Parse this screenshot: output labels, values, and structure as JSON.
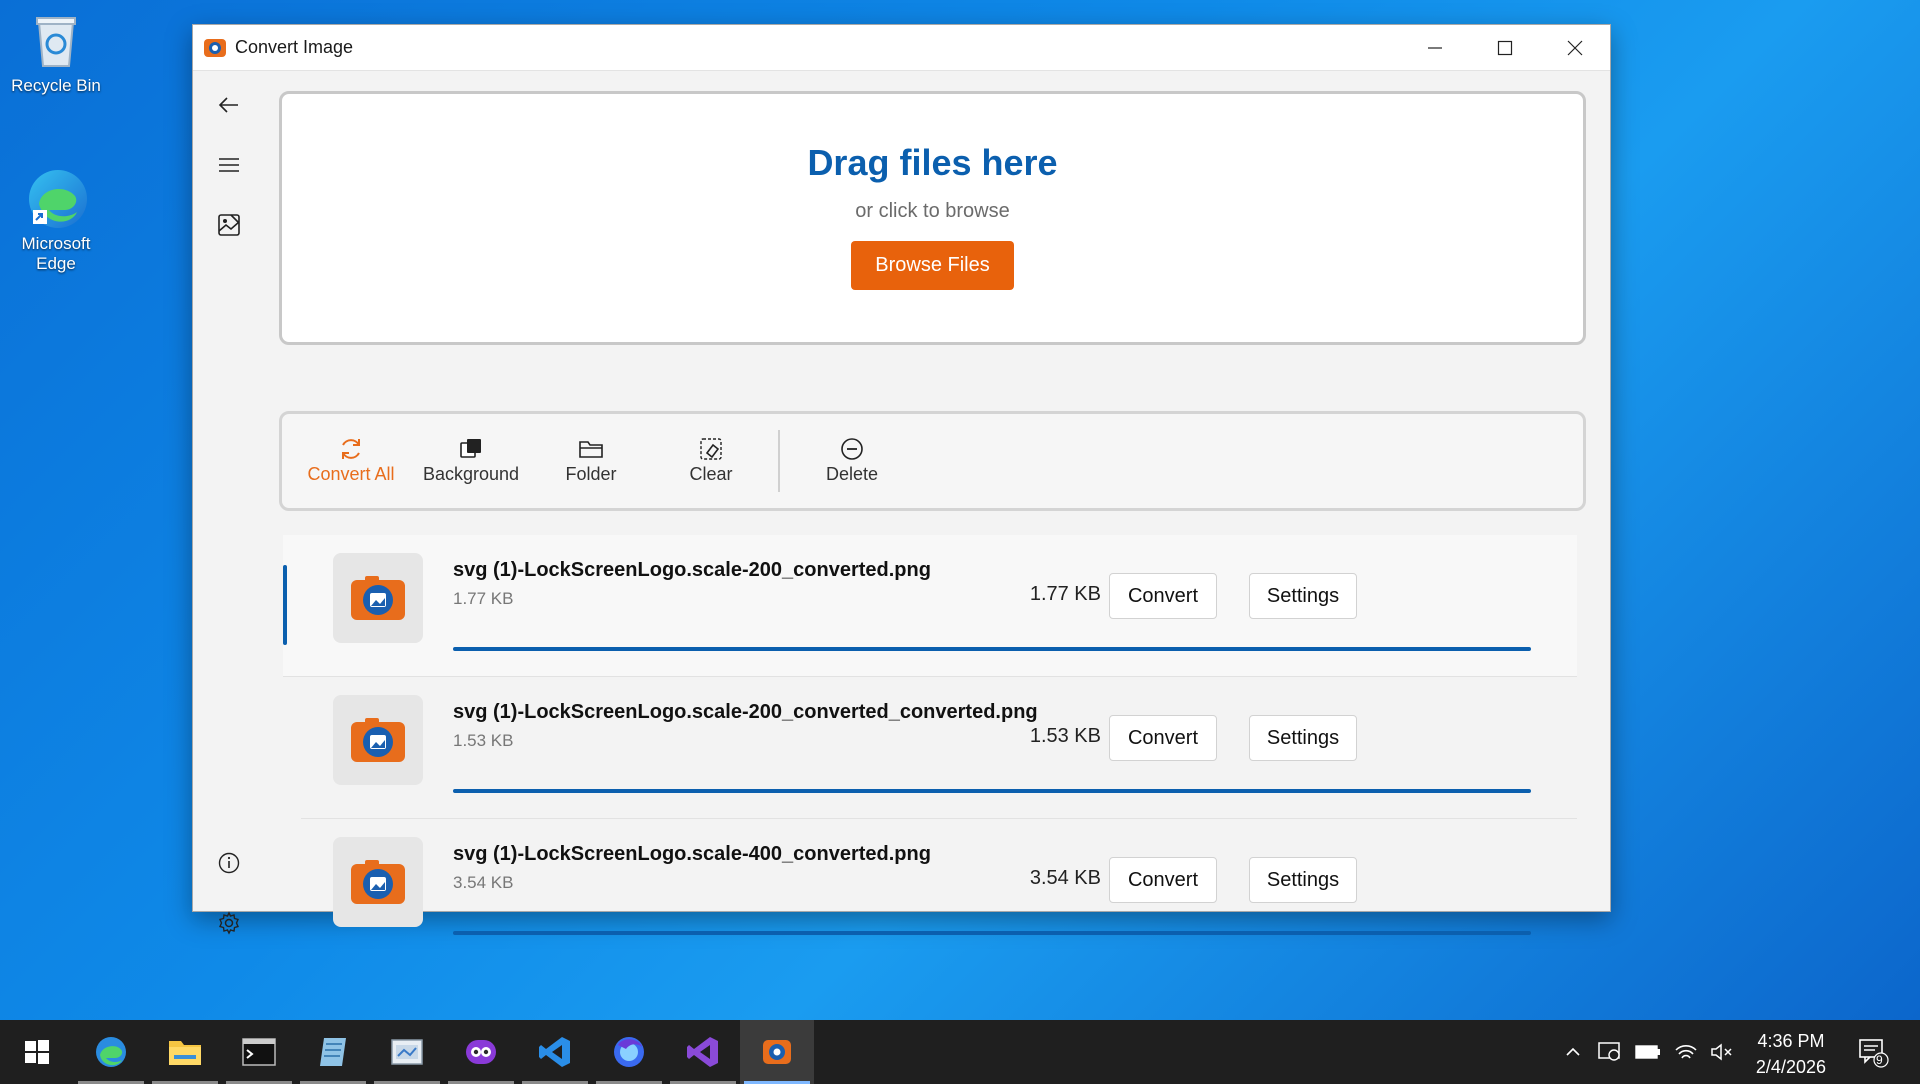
{
  "desktop": {
    "icons": [
      {
        "label": "Recycle Bin",
        "icon": "recycle-bin-icon"
      },
      {
        "label": "Microsoft Edge",
        "icon": "edge-icon"
      }
    ]
  },
  "window": {
    "title": "Convert Image",
    "controls": {
      "minimize": "minimize-icon",
      "maximize": "maximize-icon",
      "close": "close-icon"
    }
  },
  "sidebar": {
    "items": [
      {
        "name": "back",
        "icon": "back-arrow-icon"
      },
      {
        "name": "menu",
        "icon": "hamburger-icon"
      },
      {
        "name": "convert",
        "icon": "image-convert-icon"
      },
      {
        "name": "info",
        "icon": "info-icon"
      },
      {
        "name": "settings",
        "icon": "gear-icon"
      }
    ]
  },
  "dropzone": {
    "title": "Drag files here",
    "subtitle": "or click to browse",
    "browse_label": "Browse Files"
  },
  "toolbar": {
    "convert_all": "Convert All",
    "background": "Background",
    "folder": "Folder",
    "clear": "Clear",
    "delete": "Delete",
    "accent_color": "#e86d1c"
  },
  "files": [
    {
      "name": "svg (1)-LockScreenLogo.scale-200_converted.png",
      "size_sub": "1.77 KB",
      "size": "1.77 KB",
      "convert_label": "Convert",
      "settings_label": "Settings",
      "progress": 1.0,
      "selected": true
    },
    {
      "name": "svg (1)-LockScreenLogo.scale-200_converted_converted.png",
      "size_sub": "1.53 KB",
      "size": "1.53 KB",
      "convert_label": "Convert",
      "settings_label": "Settings",
      "progress": 1.0,
      "selected": false
    },
    {
      "name": "svg (1)-LockScreenLogo.scale-400_converted.png",
      "size_sub": "3.54 KB",
      "size": "3.54 KB",
      "convert_label": "Convert",
      "settings_label": "Settings",
      "progress": 1.0,
      "selected": false
    }
  ],
  "colors": {
    "primary": "#0b5fae",
    "browse_button": "#e8620c"
  },
  "taskbar": {
    "apps": [
      "start-icon",
      "edge-icon",
      "file-explorer-icon",
      "terminal-icon",
      "notepad-icon",
      "paint-icon",
      "copilot-icon",
      "vscode-icon",
      "firefox-icon",
      "visual-studio-icon",
      "convert-image-icon"
    ],
    "time": "4:36 PM",
    "date": "2/4/2026",
    "notification_count": "9"
  }
}
